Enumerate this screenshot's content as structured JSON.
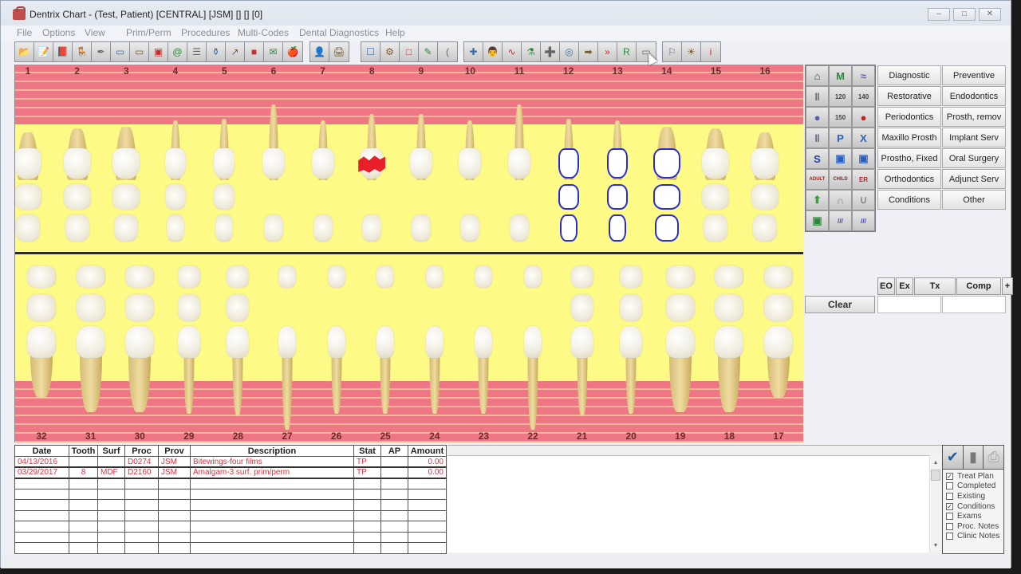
{
  "window": {
    "title": "Dentrix Chart - (Test, Patient) [CENTRAL] [JSM] [] [] [0]",
    "controls": {
      "minimize": "–",
      "maximize": "□",
      "close": "✕"
    }
  },
  "menu": [
    "File",
    "Options",
    "View",
    "Prim/Perm",
    "Procedures",
    "Multi-Codes",
    "Dental Diagnostics",
    "Help"
  ],
  "toolbar": {
    "group1": [
      {
        "icon": "open-patient-icon",
        "glyph": "📂"
      },
      {
        "icon": "edit-notes-icon",
        "glyph": "📝"
      },
      {
        "icon": "family-file-icon",
        "glyph": "📕"
      },
      {
        "icon": "appointment-book-icon",
        "glyph": "🪑"
      },
      {
        "icon": "perio-icon",
        "glyph": "✒"
      },
      {
        "icon": "ledger-icon",
        "glyph": "▭"
      },
      {
        "icon": "treatment-planner-icon",
        "glyph": "▭"
      },
      {
        "icon": "document-center-icon",
        "glyph": "▣"
      },
      {
        "icon": "office-manager-icon",
        "glyph": "@"
      },
      {
        "icon": "quick-labels-icon",
        "glyph": "☰"
      },
      {
        "icon": "prescriptions-icon",
        "glyph": "⚱"
      },
      {
        "icon": "image-icon",
        "glyph": "↗"
      },
      {
        "icon": "patient-folder-icon",
        "glyph": "■"
      },
      {
        "icon": "letters-icon",
        "glyph": "✉"
      },
      {
        "icon": "health-icon",
        "glyph": "🍎"
      }
    ],
    "group2": [
      {
        "icon": "patient-handout-icon",
        "glyph": "👤"
      },
      {
        "icon": "printer-icon",
        "glyph": "🖨"
      }
    ],
    "group3": [
      {
        "icon": "tooth-view-icon",
        "glyph": "☐"
      },
      {
        "icon": "settings-icon",
        "glyph": "⚙"
      },
      {
        "icon": "blank-icon",
        "glyph": "□"
      },
      {
        "icon": "probe-icon",
        "glyph": "✎"
      },
      {
        "icon": "instrument-icon",
        "glyph": "("
      }
    ],
    "group4": [
      {
        "icon": "medical-alert-icon",
        "glyph": "✚"
      },
      {
        "icon": "patient-info-icon",
        "glyph": "👨"
      },
      {
        "icon": "vitals-icon",
        "glyph": "∿"
      },
      {
        "icon": "lab-icon",
        "glyph": "⚗"
      },
      {
        "icon": "first-aid-icon",
        "glyph": "➕"
      },
      {
        "icon": "target-icon",
        "glyph": "◎"
      },
      {
        "icon": "next-icon",
        "glyph": "➡"
      },
      {
        "icon": "fast-forward-icon",
        "glyph": "»"
      },
      {
        "icon": "report-icon",
        "glyph": "R"
      },
      {
        "icon": "display-icon",
        "glyph": "▭"
      }
    ],
    "group5": [
      {
        "icon": "glasses-icon",
        "glyph": "⚐"
      },
      {
        "icon": "gear-sun-icon",
        "glyph": "☀"
      },
      {
        "icon": "info-icon",
        "glyph": "i"
      }
    ]
  },
  "chart": {
    "upper_teeth": [
      "1",
      "2",
      "3",
      "4",
      "5",
      "6",
      "7",
      "8",
      "9",
      "10",
      "11",
      "12",
      "13",
      "14",
      "15",
      "16"
    ],
    "lower_teeth": [
      "32",
      "31",
      "30",
      "29",
      "28",
      "27",
      "26",
      "25",
      "24",
      "23",
      "22",
      "21",
      "20",
      "19",
      "18",
      "17"
    ],
    "caries_tooth": "8",
    "outlined_teeth": [
      "12",
      "13",
      "14"
    ]
  },
  "side_panel": {
    "icon_grid": [
      "bridge-icon",
      "implant-m-icon",
      "denture-icon",
      "post-icon",
      "probe-120-icon",
      "probe-140-icon",
      "crown-icon",
      "probe-150-icon",
      "extraction-icon",
      "root-canal-icon",
      "film-p-icon",
      "film-x-icon",
      "sealant-s-icon",
      "film-a-icon",
      "film-b-icon",
      "adult-icon",
      "child-icon",
      "emergency-icon",
      "arrow-tooth-icon",
      "upper-arch-icon",
      "lower-arch-icon",
      "image-icon",
      "hatch-upper-icon",
      "hatch-lower-icon"
    ],
    "icon_glyphs": [
      "⌂",
      "M",
      "≈",
      "‖",
      "120",
      "140",
      "●",
      "150",
      "●",
      "‖",
      "P",
      "X",
      "S",
      "▣",
      "▣",
      "ADULT",
      "CHILD",
      "ER",
      "⬆",
      "∩",
      "∪",
      "▣",
      "///",
      "///"
    ],
    "categories": [
      "Diagnostic",
      "Preventive",
      "Restorative",
      "Endodontics",
      "Periodontics",
      "Prosth, remov",
      "Maxillo Prosth",
      "Implant Serv",
      "Prostho, Fixed",
      "Oral Surgery",
      "Orthodontics",
      "Adjunct Serv",
      "Conditions",
      "Other"
    ],
    "filters": {
      "eo": "EO",
      "ex": "Ex",
      "tx": "Tx",
      "comp": "Comp",
      "plus": "+"
    },
    "clear": "Clear"
  },
  "procedures": {
    "columns": [
      "Date",
      "Tooth",
      "Surf",
      "Proc",
      "Prov",
      "Description",
      "Stat",
      "AP",
      "Amount"
    ],
    "rows": [
      {
        "date": "04/13/2016",
        "tooth": "",
        "surf": "",
        "proc": "D0274",
        "prov": "JSM",
        "description": "Bitewings-four films",
        "stat": "TP",
        "ap": "",
        "amount": "0.00"
      },
      {
        "date": "03/29/2017",
        "tooth": "8",
        "surf": "MDF",
        "proc": "D2160",
        "prov": "JSM",
        "description": "Amalgam-3 surf. prim/perm",
        "stat": "TP",
        "ap": "",
        "amount": "0.00"
      }
    ],
    "empty_rows": 7
  },
  "view_filters": {
    "icons": [
      "checkmark-icon",
      "trash-icon",
      "printer-icon"
    ],
    "items": [
      {
        "label": "Treat Plan",
        "checked": true
      },
      {
        "label": "Completed",
        "checked": false
      },
      {
        "label": "Existing",
        "checked": false
      },
      {
        "label": "Conditions",
        "checked": true
      },
      {
        "label": "Exams",
        "checked": false
      },
      {
        "label": "Proc. Notes",
        "checked": false
      },
      {
        "label": "Clinic Notes",
        "checked": false
      }
    ]
  },
  "colors": {
    "gum": "#ef7684",
    "chart_bg": "#fdfb85",
    "caries": "#e8202a",
    "selected_outline": "#2b2bd6",
    "procedure_text": "#e03040"
  }
}
